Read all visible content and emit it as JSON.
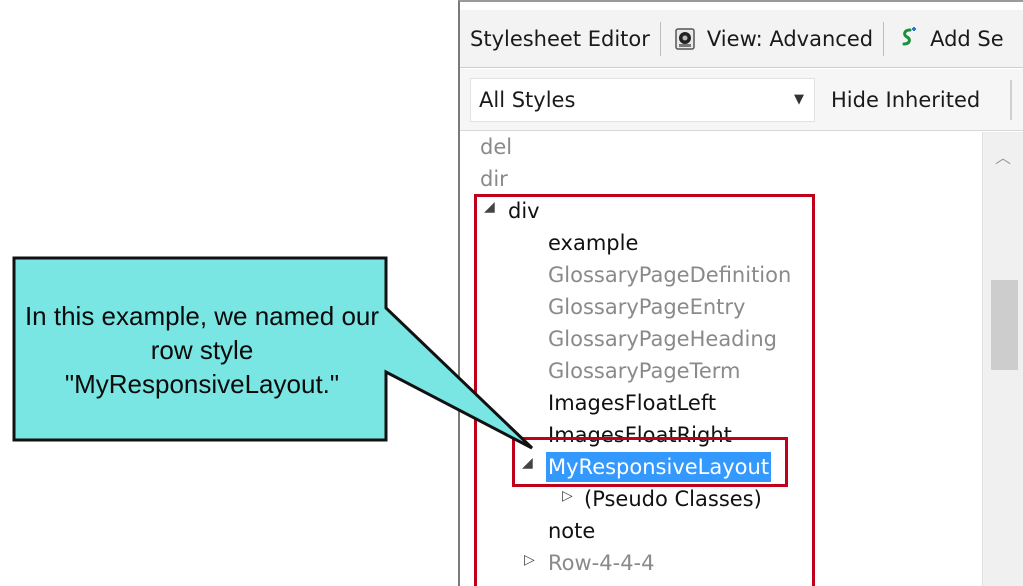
{
  "toolbar": {
    "title": "Stylesheet Editor",
    "view_label": "View: Advanced",
    "add_label": "Add Se"
  },
  "filter": {
    "selected": "All Styles",
    "hide_inherited": "Hide Inherited"
  },
  "tree": {
    "del": "del",
    "dir": "dir",
    "div": "div",
    "children": {
      "example": "example",
      "glossary_def": "GlossaryPageDefinition",
      "glossary_entry": "GlossaryPageEntry",
      "glossary_heading": "GlossaryPageHeading",
      "glossary_term": "GlossaryPageTerm",
      "images_left": "ImagesFloatLeft",
      "images_right": "ImagesFloatRight",
      "my_responsive": "MyResponsiveLayout",
      "pseudo": "(Pseudo Classes)",
      "note": "note",
      "row444": "Row-4-4-4"
    }
  },
  "callout": {
    "text": "In this example, we named our row style \"MyResponsiveLayout.\""
  },
  "colors": {
    "callout_fill": "#79e6e3",
    "highlight_red": "#c0001a",
    "selection_blue": "#3399ff"
  },
  "icons": [
    "toolbar-view-icon",
    "add-selector-icon",
    "dropdown-arrow-icon",
    "expand-icon",
    "collapse-icon",
    "scroll-up-icon"
  ]
}
